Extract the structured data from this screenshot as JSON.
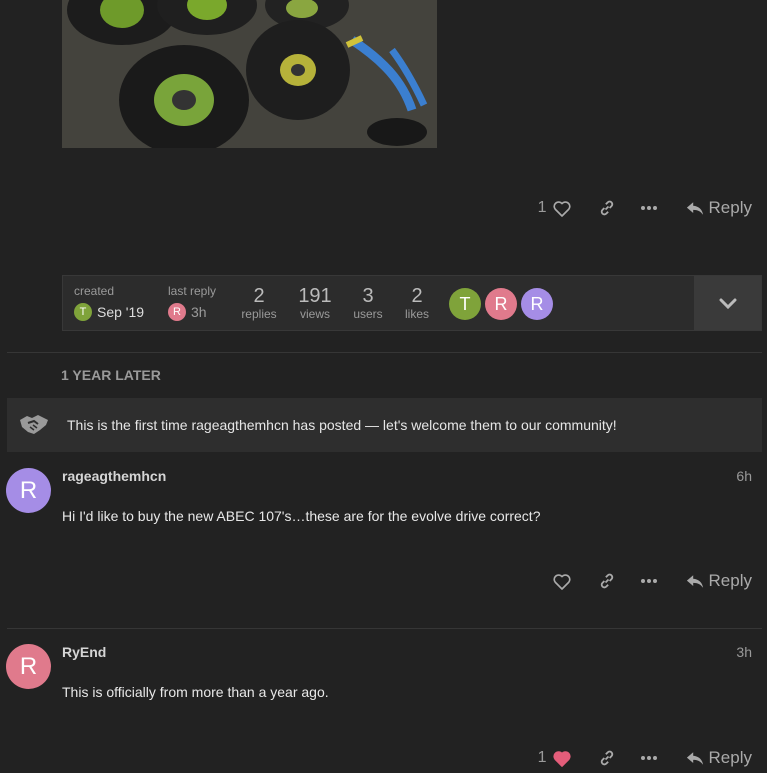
{
  "post_top": {
    "like_count": "1",
    "reply_label": "Reply"
  },
  "topic_map": {
    "created_label": "created",
    "created_date": "Sep '19",
    "created_avatar_letter": "T",
    "last_reply_label": "last reply",
    "last_reply_time": "3h",
    "last_reply_avatar_letter": "R",
    "stats": [
      {
        "num": "2",
        "label": "replies"
      },
      {
        "num": "191",
        "label": "views"
      },
      {
        "num": "3",
        "label": "users"
      },
      {
        "num": "2",
        "label": "likes"
      }
    ],
    "participants": [
      {
        "letter": "T",
        "color": "#7fa33a"
      },
      {
        "letter": "R",
        "color": "#e07a8c"
      },
      {
        "letter": "R",
        "color": "#a58de6"
      }
    ]
  },
  "time_gap": "1 YEAR LATER",
  "notice": "This is the first time rageagthemhcn has posted — let's welcome them to our community!",
  "posts": [
    {
      "avatar_letter": "R",
      "avatar_color": "#a58de6",
      "username": "rageagthemhcn",
      "time": "6h",
      "body": "Hi I'd like to buy the new ABEC 107's…these are for the evolve drive correct?",
      "like_count": "",
      "reply_label": "Reply"
    },
    {
      "avatar_letter": "R",
      "avatar_color": "#e07a8c",
      "username": "RyEnd",
      "time": "3h",
      "body": "This is officially from more than a year ago.",
      "like_count": "1",
      "reply_label": "Reply"
    }
  ],
  "colors": {
    "background": "#222222",
    "liked_heart": "#e45d7a"
  }
}
